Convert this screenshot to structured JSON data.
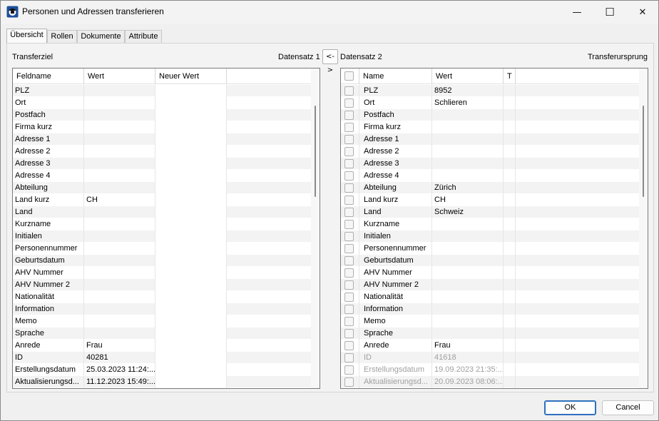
{
  "window": {
    "title": "Personen und Adressen transferieren",
    "minimize_glyph": "—",
    "maximize_glyph": "☐",
    "close_glyph": "✕"
  },
  "tabs": [
    {
      "label": "Übersicht",
      "active": true
    },
    {
      "label": "Rollen",
      "active": false
    },
    {
      "label": "Dokumente",
      "active": false
    },
    {
      "label": "Attribute",
      "active": false
    }
  ],
  "overview": {
    "target_label": "Transferziel",
    "source_label": "Transferursprung",
    "record1_label": "Datensatz 1",
    "record2_label": "Datensatz 2",
    "swap_label": "<->"
  },
  "left_grid": {
    "headers": [
      "Feldname",
      "Wert",
      "Neuer Wert"
    ],
    "rows": [
      {
        "field": "PLZ",
        "value": "",
        "new_value": ""
      },
      {
        "field": "Ort",
        "value": "",
        "new_value": ""
      },
      {
        "field": "Postfach",
        "value": "",
        "new_value": ""
      },
      {
        "field": "Firma kurz",
        "value": "",
        "new_value": ""
      },
      {
        "field": "Adresse 1",
        "value": "",
        "new_value": ""
      },
      {
        "field": "Adresse 2",
        "value": "",
        "new_value": ""
      },
      {
        "field": "Adresse 3",
        "value": "",
        "new_value": ""
      },
      {
        "field": "Adresse 4",
        "value": "",
        "new_value": ""
      },
      {
        "field": "Abteilung",
        "value": "",
        "new_value": ""
      },
      {
        "field": "Land kurz",
        "value": "CH",
        "new_value": ""
      },
      {
        "field": "Land",
        "value": "",
        "new_value": ""
      },
      {
        "field": "Kurzname",
        "value": "",
        "new_value": ""
      },
      {
        "field": "Initialen",
        "value": "",
        "new_value": ""
      },
      {
        "field": "Personennummer",
        "value": "",
        "new_value": ""
      },
      {
        "field": "Geburtsdatum",
        "value": "",
        "new_value": ""
      },
      {
        "field": "AHV Nummer",
        "value": "",
        "new_value": ""
      },
      {
        "field": "AHV Nummer 2",
        "value": "",
        "new_value": ""
      },
      {
        "field": "Nationalität",
        "value": "",
        "new_value": ""
      },
      {
        "field": "Information",
        "value": "",
        "new_value": ""
      },
      {
        "field": "Memo",
        "value": "",
        "new_value": ""
      },
      {
        "field": "Sprache",
        "value": "",
        "new_value": ""
      },
      {
        "field": "Anrede",
        "value": "Frau",
        "new_value": ""
      },
      {
        "field": "ID",
        "value": "40281",
        "new_value": ""
      },
      {
        "field": "Erstellungsdatum",
        "value": "25.03.2023 11:24:...",
        "new_value": ""
      },
      {
        "field": "Aktualisierungsd...",
        "value": "11.12.2023 15:49:...",
        "new_value": ""
      }
    ]
  },
  "right_grid": {
    "headers": [
      "",
      "Name",
      "Wert",
      "T"
    ],
    "rows": [
      {
        "name": "PLZ",
        "value": "8952",
        "disabled": false
      },
      {
        "name": "Ort",
        "value": "Schlieren",
        "disabled": false
      },
      {
        "name": "Postfach",
        "value": "",
        "disabled": false
      },
      {
        "name": "Firma kurz",
        "value": "",
        "disabled": false
      },
      {
        "name": "Adresse 1",
        "value": "",
        "disabled": false
      },
      {
        "name": "Adresse 2",
        "value": "",
        "disabled": false
      },
      {
        "name": "Adresse 3",
        "value": "",
        "disabled": false
      },
      {
        "name": "Adresse 4",
        "value": "",
        "disabled": false
      },
      {
        "name": "Abteilung",
        "value": "Zürich",
        "disabled": false
      },
      {
        "name": "Land kurz",
        "value": "CH",
        "disabled": false
      },
      {
        "name": "Land",
        "value": "Schweiz",
        "disabled": false
      },
      {
        "name": "Kurzname",
        "value": "",
        "disabled": false
      },
      {
        "name": "Initialen",
        "value": "",
        "disabled": false
      },
      {
        "name": "Personennummer",
        "value": "",
        "disabled": false
      },
      {
        "name": "Geburtsdatum",
        "value": "",
        "disabled": false
      },
      {
        "name": "AHV Nummer",
        "value": "",
        "disabled": false
      },
      {
        "name": "AHV Nummer 2",
        "value": "",
        "disabled": false
      },
      {
        "name": "Nationalität",
        "value": "",
        "disabled": false
      },
      {
        "name": "Information",
        "value": "",
        "disabled": false
      },
      {
        "name": "Memo",
        "value": "",
        "disabled": false
      },
      {
        "name": "Sprache",
        "value": "",
        "disabled": false
      },
      {
        "name": "Anrede",
        "value": "Frau",
        "disabled": false
      },
      {
        "name": "ID",
        "value": "41618",
        "disabled": true
      },
      {
        "name": "Erstellungsdatum",
        "value": "19.09.2023 21:35:...",
        "disabled": true
      },
      {
        "name": "Aktualisierungsd...",
        "value": "20.09.2023 08:06:...",
        "disabled": true
      }
    ]
  },
  "buttons": {
    "ok": "OK",
    "cancel": "Cancel"
  },
  "colors": {
    "accent": "#2f6fbf",
    "disabled_text": "#a0a0a0"
  }
}
